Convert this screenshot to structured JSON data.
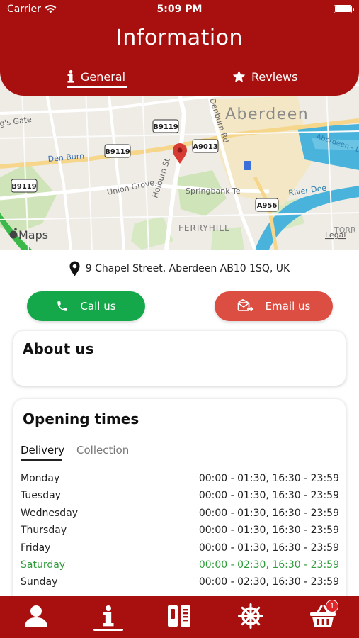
{
  "status_bar": {
    "carrier": "Carrier",
    "time": "5:09 PM"
  },
  "header": {
    "title": "Information",
    "tabs": [
      {
        "label": "General",
        "icon": "info-icon",
        "active": true
      },
      {
        "label": "Reviews",
        "icon": "star-icon",
        "active": false
      }
    ]
  },
  "map": {
    "place_labels": [
      "Aberdeen",
      "FERRYHILL",
      "TORR",
      "Den Burn",
      "Union Grove",
      "Springbank Te",
      "River Dee",
      "Aberdeen - Le",
      "g's Gate"
    ],
    "street_labels": [
      "Holburn St",
      "Denburn Rd"
    ],
    "road_badges": [
      "B9119",
      "B9119",
      "B9119",
      "A9013",
      "A956"
    ],
    "attribution": "Maps",
    "legal": "Legal"
  },
  "address": "9 Chapel Street, Aberdeen AB10 1SQ, UK",
  "actions": {
    "call_label": "Call us",
    "email_label": "Email us"
  },
  "about": {
    "title": "About us"
  },
  "opening_times": {
    "title": "Opening times",
    "tabs": [
      "Delivery",
      "Collection"
    ],
    "active_tab": "Delivery",
    "rows": [
      {
        "day": "Monday",
        "hours": "00:00 - 01:30, 16:30 - 23:59",
        "today": false
      },
      {
        "day": "Tuesday",
        "hours": "00:00 - 01:30, 16:30 - 23:59",
        "today": false
      },
      {
        "day": "Wednesday",
        "hours": "00:00 - 01:30, 16:30 - 23:59",
        "today": false
      },
      {
        "day": "Thursday",
        "hours": "00:00 - 01:30, 16:30 - 23:59",
        "today": false
      },
      {
        "day": "Friday",
        "hours": "00:00 - 01:30, 16:30 - 23:59",
        "today": false
      },
      {
        "day": "Saturday",
        "hours": "00:00 - 02:30, 16:30 - 23:59",
        "today": true
      },
      {
        "day": "Sunday",
        "hours": "00:00 - 02:30, 16:30 - 23:59",
        "today": false
      }
    ]
  },
  "bottom_nav": {
    "items": [
      "profile-icon",
      "info-icon",
      "menu-book-icon",
      "settings-wheel-icon",
      "basket-icon"
    ],
    "active": "info-icon",
    "cart_count": "1"
  },
  "colors": {
    "brand_red": "#a8100f",
    "call_green": "#14a84a",
    "email_red": "#dc4e42",
    "today_green": "#2e9c3a",
    "water_blue": "#49b3dc"
  }
}
